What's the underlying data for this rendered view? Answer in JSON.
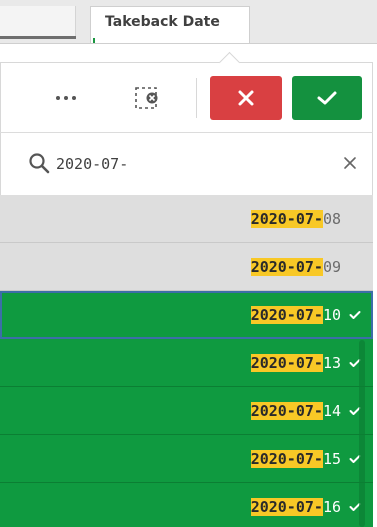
{
  "tab": {
    "active_label": "Takeback Date"
  },
  "toolbar": {
    "more_icon": "more-horizontal-icon",
    "clear_selections_icon": "clear-selections-icon",
    "cancel_icon": "close-icon",
    "confirm_icon": "checkmark-icon"
  },
  "search": {
    "value": "2020-07-",
    "icon": "search-icon",
    "clear_icon": "close-icon"
  },
  "colors": {
    "selected": "#0f9a40",
    "optional": "#dedede",
    "highlight": "#f8c826",
    "cancel": "#d94042",
    "confirm": "#14913f",
    "focus": "#3c6ea8"
  },
  "list": {
    "items": [
      {
        "match": "2020-07-",
        "rest": "08",
        "state": "optional"
      },
      {
        "match": "2020-07-",
        "rest": "09",
        "state": "optional"
      },
      {
        "match": "2020-07-",
        "rest": "10",
        "state": "selected"
      },
      {
        "match": "2020-07-",
        "rest": "13",
        "state": "selected"
      },
      {
        "match": "2020-07-",
        "rest": "14",
        "state": "selected"
      },
      {
        "match": "2020-07-",
        "rest": "15",
        "state": "selected"
      },
      {
        "match": "2020-07-",
        "rest": "16",
        "state": "selected"
      }
    ]
  }
}
